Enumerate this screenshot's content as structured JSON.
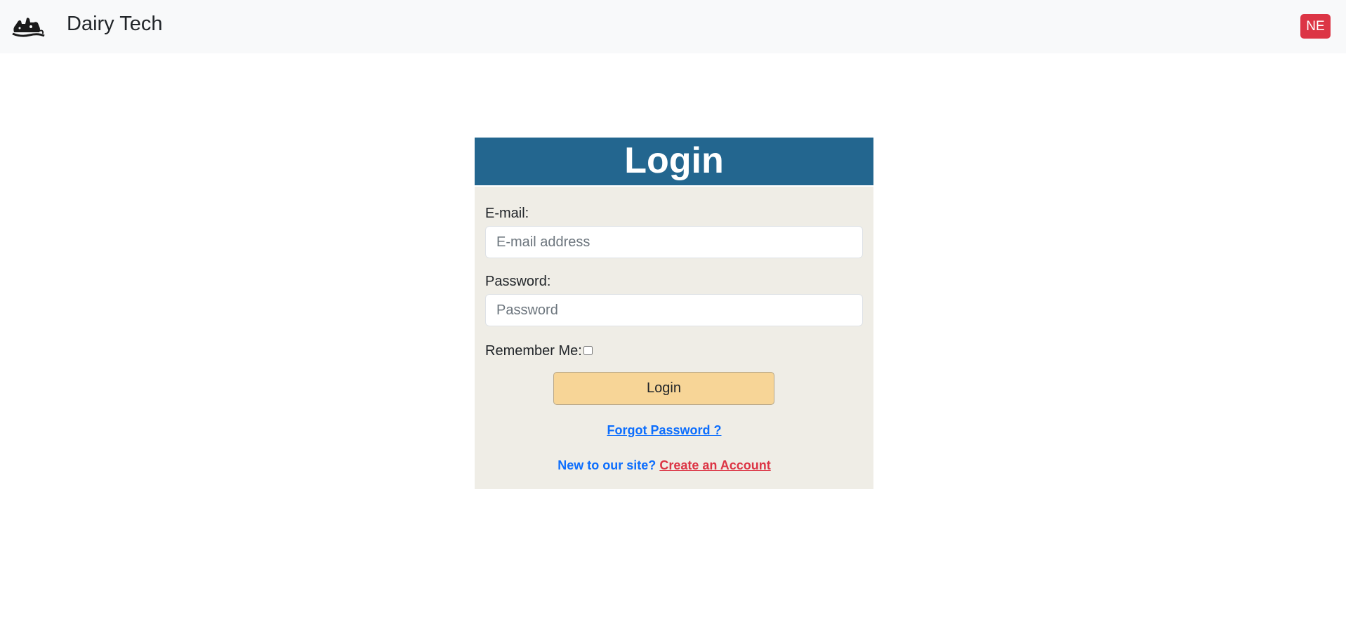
{
  "navbar": {
    "logo_icon": "cow-silhouette-icon",
    "brand_title": "Dairy Tech",
    "user_badge": "NE",
    "background": "#f8f9fa",
    "badge_color": "#dc3545"
  },
  "login_card": {
    "header_title": "Login",
    "header_color": "#23668f",
    "card_background": "#efede6",
    "email": {
      "label": "E-mail:",
      "placeholder": "E-mail address",
      "value": ""
    },
    "password": {
      "label": "Password:",
      "placeholder": "Password",
      "value": ""
    },
    "remember_me": {
      "label": "Remember Me:",
      "checked": false
    },
    "login_button": {
      "label": "Login",
      "color": "#f7d597"
    },
    "forgot_password_link": "Forgot Password ?",
    "signup_prompt": "New to our site?",
    "create_account_link": "Create an Account"
  }
}
